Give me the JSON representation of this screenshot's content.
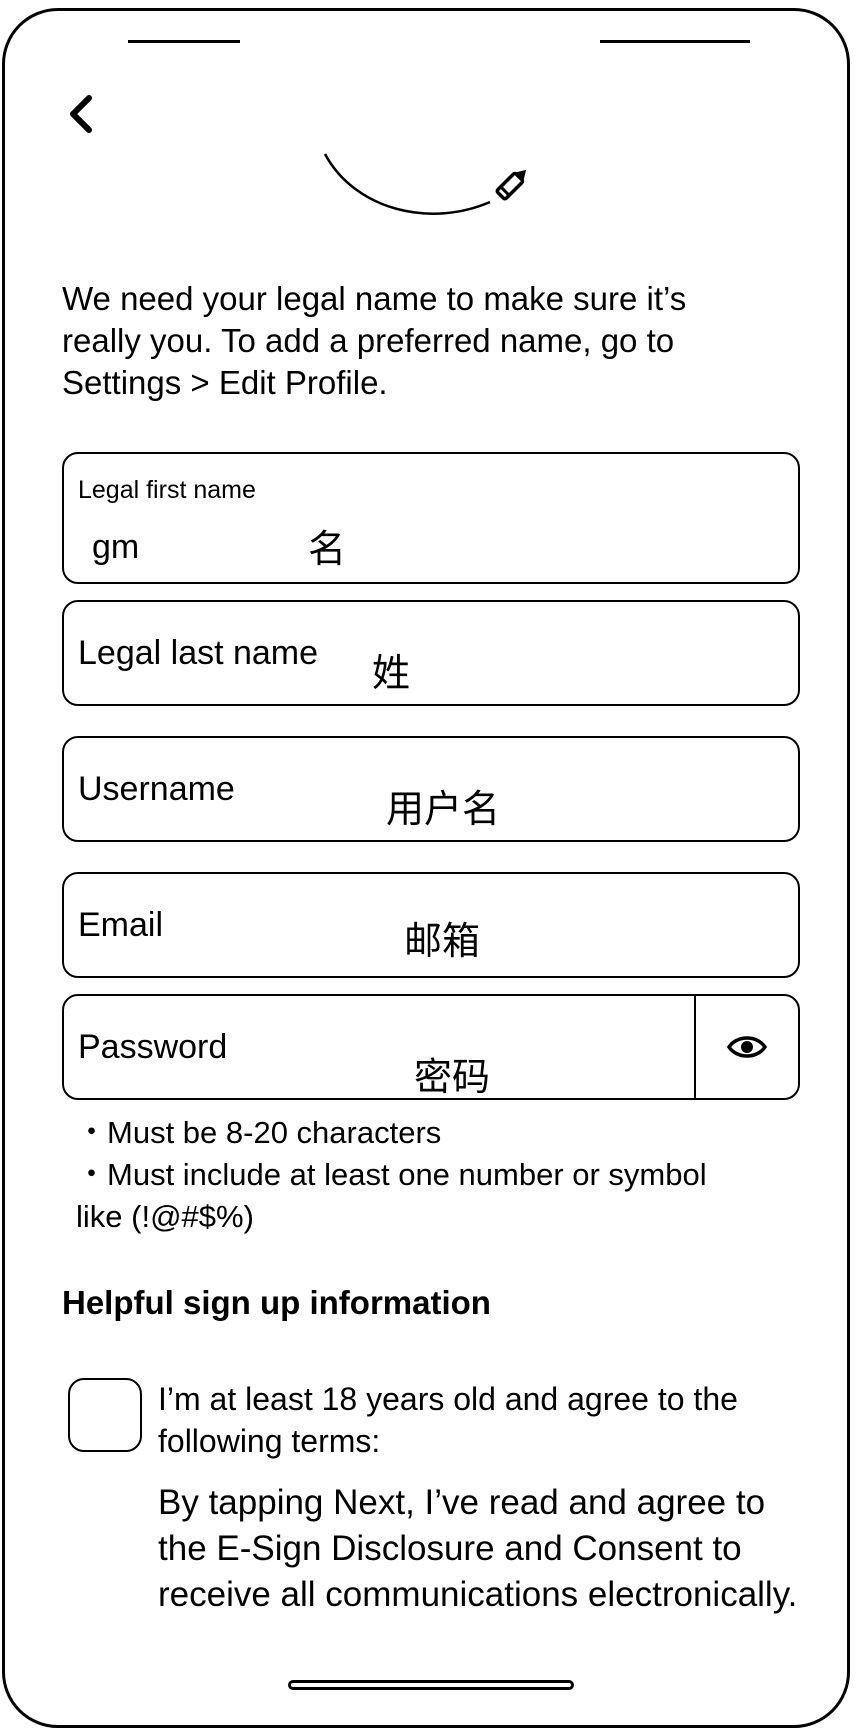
{
  "intro_text": "We need your legal name to make sure it’s really you. To add a preferred name, go to Settings > Edit Profile.",
  "fields": {
    "first_name": {
      "label": "Legal first name",
      "value": "gm",
      "hint_cn": "名"
    },
    "last_name": {
      "label": "Legal last name",
      "hint_cn": "姓"
    },
    "username": {
      "label": "Username",
      "hint_cn": "用户名"
    },
    "email": {
      "label": "Email",
      "hint_cn": "邮箱"
    },
    "password": {
      "label": "Password",
      "hint_cn": "密码"
    }
  },
  "password_rules": [
    "・Must be 8-20 characters",
    "・Must include at least one number or symbol like (!@#$%)"
  ],
  "section_title": "Helpful sign up information",
  "agree_text": "I’m at least 18 years old and agree to the following terms:",
  "consent_text": "By tapping Next, I’ve read and agree to the E-Sign Disclosure and Consent to receive all communications electronically.",
  "icons": {
    "back": "chevron-left-icon",
    "edit": "pencil-icon",
    "visibility": "eye-icon"
  }
}
